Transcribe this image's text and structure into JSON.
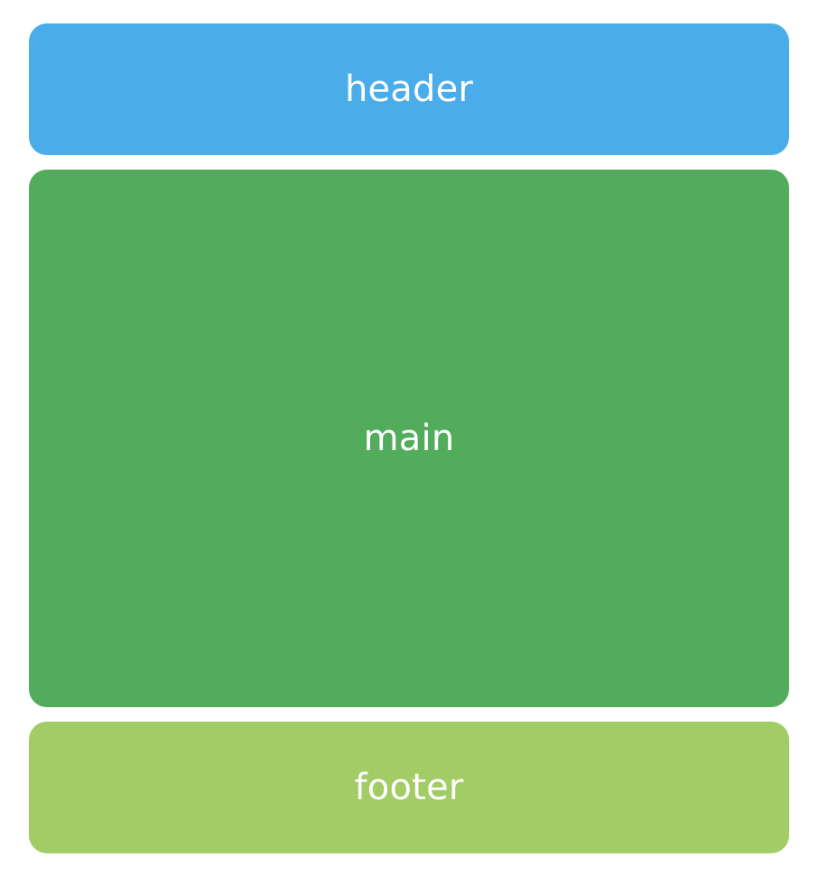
{
  "blocks": {
    "header": {
      "label": "header",
      "color": "#4AADE9"
    },
    "main": {
      "label": "main",
      "color": "#52AC5B"
    },
    "footer": {
      "label": "footer",
      "color": "#A2CC65"
    }
  }
}
